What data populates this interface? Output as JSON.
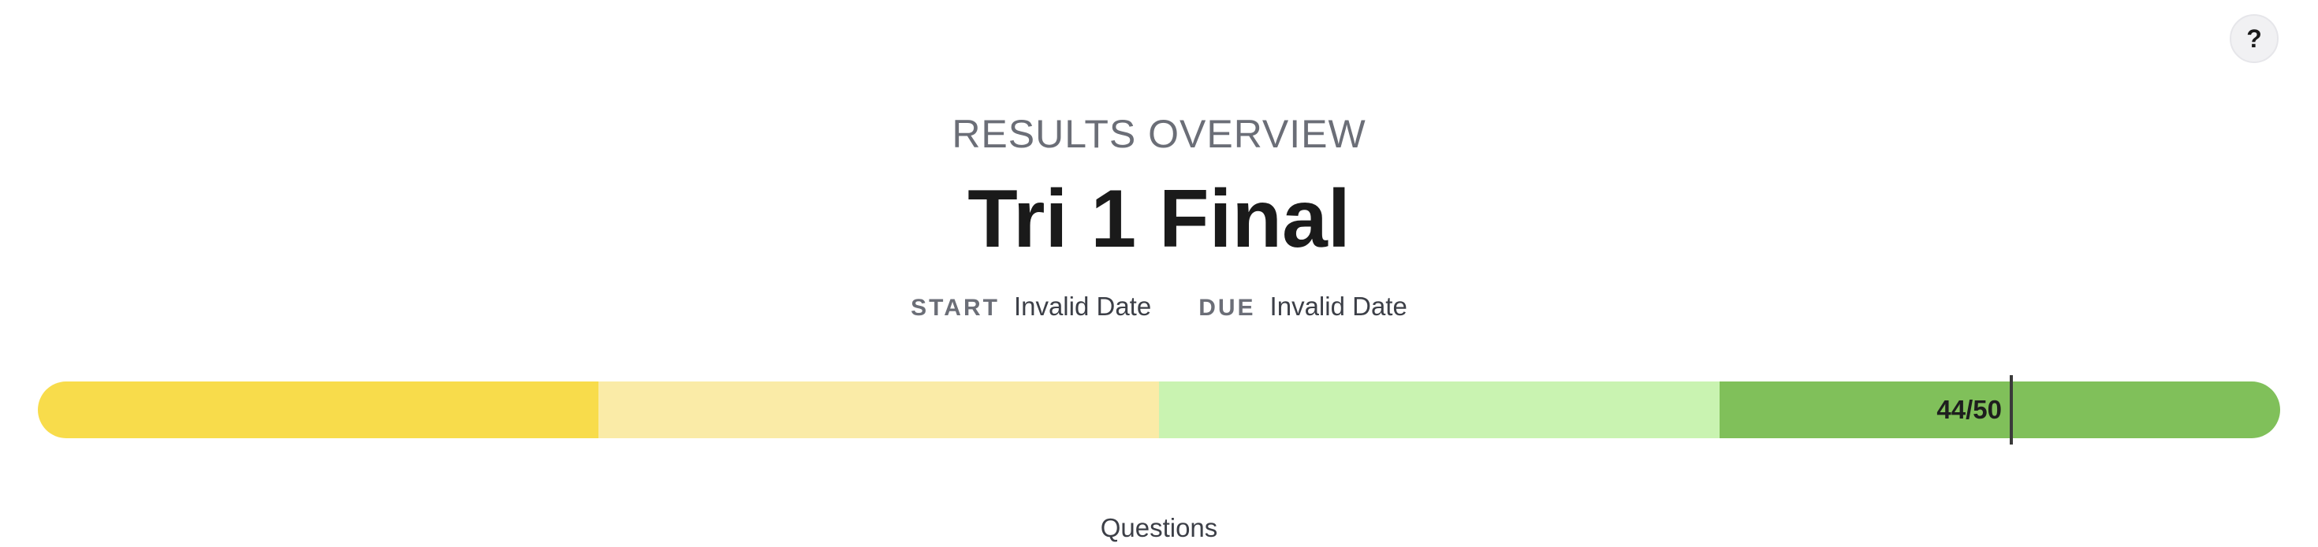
{
  "help_button": {
    "label": "?"
  },
  "header": {
    "eyebrow": "RESULTS OVERVIEW",
    "title": "Tri 1 Final"
  },
  "dates": {
    "start_label": "START",
    "start_value": "Invalid Date",
    "due_label": "DUE",
    "due_value": "Invalid Date"
  },
  "score": {
    "earned": 44,
    "total": 50,
    "label": "44/50"
  },
  "score_bands": [
    {
      "color": "#f8dc4b"
    },
    {
      "color": "#faeba7"
    },
    {
      "color": "#c9f3b1"
    },
    {
      "color": "#80c05a"
    }
  ],
  "sections": {
    "questions_heading": "Questions"
  }
}
